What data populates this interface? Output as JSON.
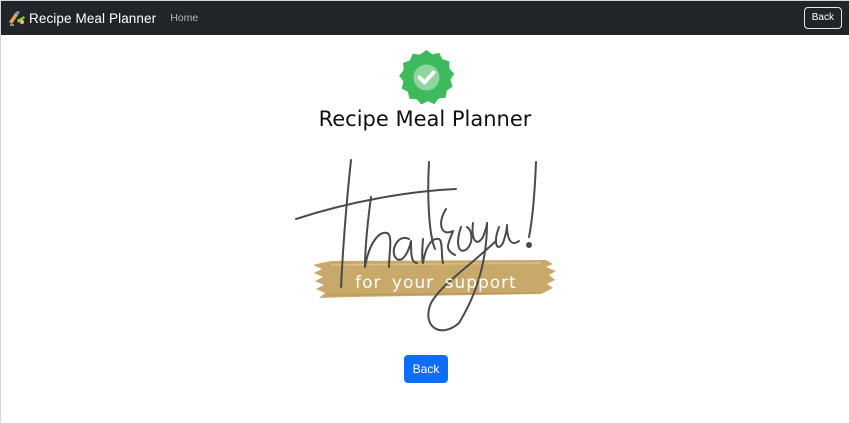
{
  "navbar": {
    "brand_label": "Recipe Meal Planner",
    "brand_icon": "recipe-logo-icon",
    "home_link": "Home",
    "back_label": "Back"
  },
  "main": {
    "badge_icon": "verified-check-badge-icon",
    "title": "Recipe Meal Planner",
    "thank_you_script": "thank you!",
    "support_text": "for your support",
    "back_label": "Back"
  },
  "colors": {
    "navbar_bg": "#212529",
    "badge_green": "#3dbb5c",
    "brush_gold": "#c8a96a",
    "primary_button": "#0d6efd"
  }
}
